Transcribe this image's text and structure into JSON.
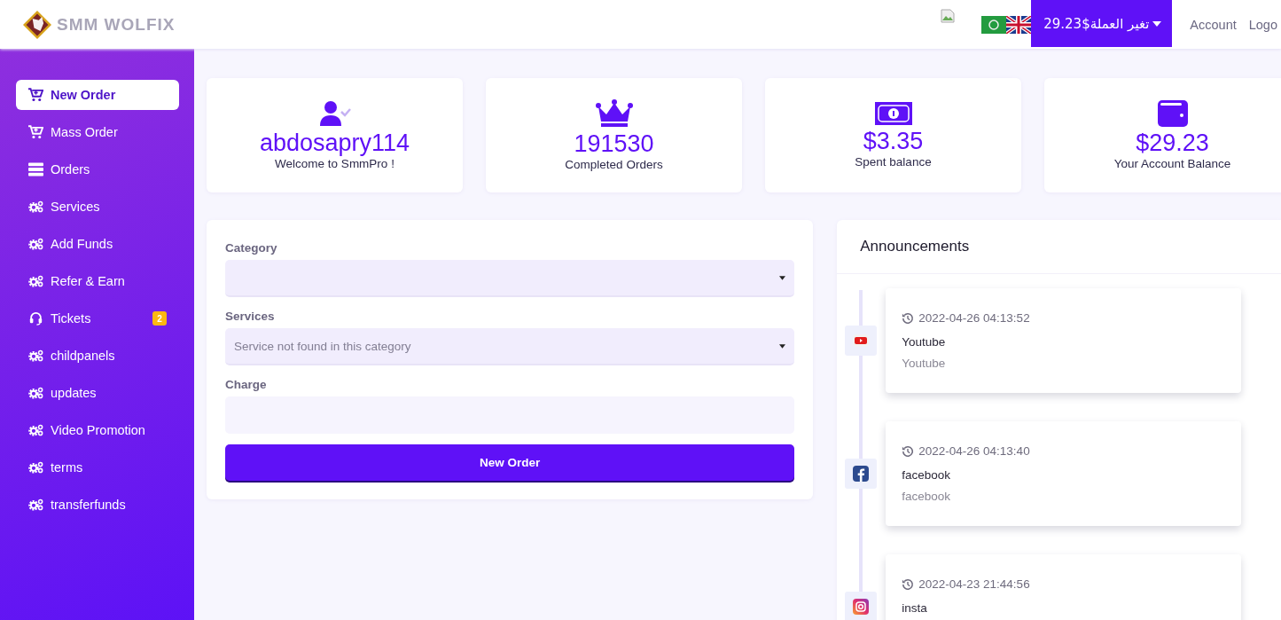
{
  "header": {
    "logo": "SMM WOLFIX",
    "currency_button": "29.23$تغير العملة",
    "nav": [
      "Account",
      "Logo"
    ]
  },
  "sidebar": {
    "items": [
      {
        "label": "New Order",
        "kind": "cart",
        "selected": true
      },
      {
        "label": "Mass Order",
        "kind": "cart",
        "selected": false
      },
      {
        "label": "Orders",
        "kind": "server",
        "selected": false
      },
      {
        "label": "Services",
        "kind": "gears",
        "selected": false
      },
      {
        "label": "Add Funds",
        "kind": "gears",
        "selected": false
      },
      {
        "label": "Refer & Earn",
        "kind": "gears",
        "selected": false
      },
      {
        "label": "Tickets",
        "kind": "headset",
        "selected": false,
        "badge": "2"
      },
      {
        "label": "childpanels",
        "kind": "gears",
        "selected": false
      },
      {
        "label": "updates",
        "kind": "gears",
        "selected": false
      },
      {
        "label": "Video Promotion",
        "kind": "gears",
        "selected": false
      },
      {
        "label": "terms",
        "kind": "gears",
        "selected": false
      },
      {
        "label": "transferfunds",
        "kind": "gears",
        "selected": false
      }
    ]
  },
  "stats": [
    {
      "kind": "user",
      "value": "abdosapry114",
      "label": "Welcome to SmmPro !"
    },
    {
      "kind": "crown",
      "value": "191530",
      "label": "Completed Orders"
    },
    {
      "kind": "money",
      "value": "$3.35",
      "label": "Spent balance"
    },
    {
      "kind": "wallet",
      "value": "$29.23",
      "label": "Your Account Balance"
    }
  ],
  "order_form": {
    "fields": [
      {
        "label": "Category",
        "kind": "select"
      },
      {
        "label": "Services",
        "kind": "select",
        "placeholder": "Service not found in this category"
      },
      {
        "label": "Charge",
        "kind": "input"
      }
    ],
    "button": "New Order"
  },
  "announcements": {
    "title": "Announcements",
    "items": [
      {
        "kind": "youtube",
        "time": "2022-04-26 04:13:52",
        "title": "Youtube",
        "text": "Youtube"
      },
      {
        "kind": "facebook",
        "time": "2022-04-26 04:13:40",
        "title": "facebook",
        "text": "facebook"
      },
      {
        "kind": "instagram",
        "time": "2022-04-23 21:44:56",
        "title": "insta"
      }
    ]
  }
}
